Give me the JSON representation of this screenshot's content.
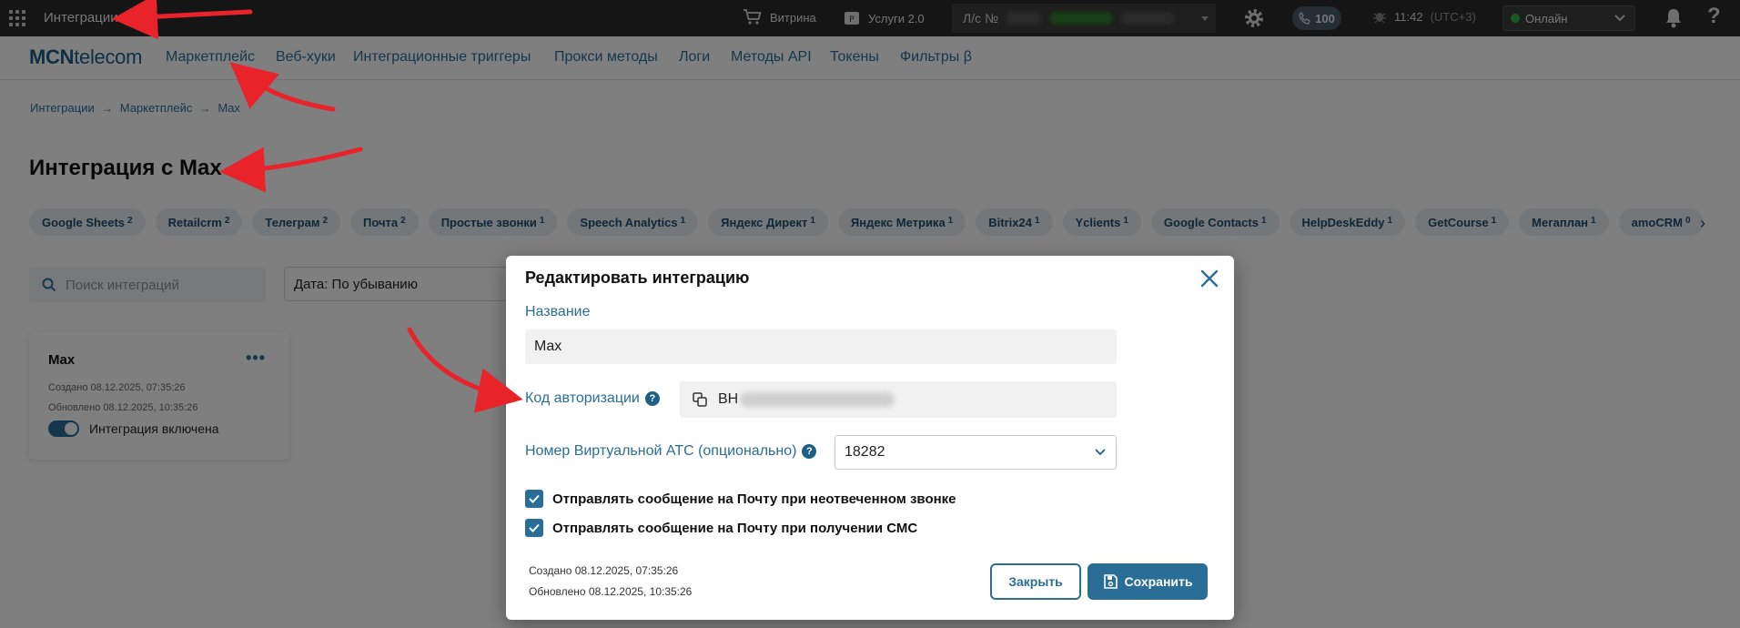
{
  "topbar": {
    "app_title": "Интеграции",
    "showcase_label": "Витрина",
    "services_label": "Услуги 2.0",
    "account_prefix": "Л/с №",
    "calls_count": "100",
    "time": "11:42",
    "timezone": "(UTC+3)",
    "status_value": "Онлайн",
    "help_label": "?"
  },
  "nav": {
    "logo_bold": "MCN",
    "logo_rest": "telecom",
    "links": [
      "Маркетплейс",
      "Веб-хуки",
      "Интеграционные триггеры",
      "Прокси методы",
      "Логи",
      "Методы API",
      "Токены",
      "Фильтры β"
    ]
  },
  "breadcrumbs": [
    "Интеграции",
    "Маркетплейс",
    "Max"
  ],
  "page_title": "Интеграция с Max",
  "chips": [
    {
      "label": "Google Sheets",
      "count": "2"
    },
    {
      "label": "Retailcrm",
      "count": "2"
    },
    {
      "label": "Телеграм",
      "count": "2"
    },
    {
      "label": "Почта",
      "count": "2"
    },
    {
      "label": "Простые звонки",
      "count": "1"
    },
    {
      "label": "Speech Analytics",
      "count": "1"
    },
    {
      "label": "Яндекс Директ",
      "count": "1"
    },
    {
      "label": "Яндекс Метрика",
      "count": "1"
    },
    {
      "label": "Bitrix24",
      "count": "1"
    },
    {
      "label": "Yclients",
      "count": "1"
    },
    {
      "label": "Google Contacts",
      "count": "1"
    },
    {
      "label": "HelpDeskEddy",
      "count": "1"
    },
    {
      "label": "GetCourse",
      "count": "1"
    },
    {
      "label": "Мегаплан",
      "count": "1"
    },
    {
      "label": "amoCRM",
      "count": "0"
    }
  ],
  "filters": {
    "search_placeholder": "Поиск интеграций",
    "sort_value": "Дата: По убыванию"
  },
  "card": {
    "title": "Max",
    "menu_label": "•••",
    "created": "Создано 08.12.2025, 07:35:26",
    "updated": "Обновлено 08.12.2025, 10:35:26",
    "toggle_label": "Интеграция включена"
  },
  "modal": {
    "title": "Редактировать интеграцию",
    "name_label": "Название",
    "name_value": "Max",
    "auth_label": "Код авторизации",
    "auth_visible": "BH",
    "ats_label": "Номер Виртуальной АТС (опционально)",
    "ats_value": "18282",
    "checkbox_missed": "Отправлять сообщение на Почту при неотвеченном звонке",
    "checkbox_sms": "Отправлять сообщение на Почту при получении СМС",
    "created": "Создано 08.12.2025, 07:35:26",
    "updated": "Обновлено 08.12.2025, 10:35:26",
    "close_label": "Закрыть",
    "save_label": "Сохранить"
  },
  "colors": {
    "accent": "#2a6e98",
    "topbar": "#2b2b2b",
    "online": "#39b54a",
    "arrow": "#e8232a"
  }
}
